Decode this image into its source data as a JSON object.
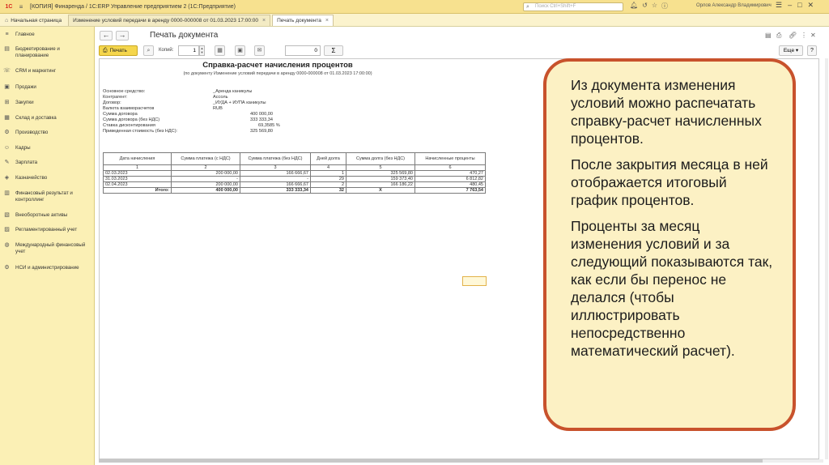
{
  "titlebar": {
    "app_title": "[КОПИЯ] Финаренда / 1С:ERP Управление предприятием 2  (1С:Предприятие)",
    "search_placeholder": "Поиск Ctrl+Shift+F",
    "user": "Орлов Александр Владимирович"
  },
  "tabs": {
    "home": "Начальная страница",
    "items": [
      {
        "label": "Изменение условий передачи в аренду 0000-000008 от 01.03.2023 17:00:00"
      },
      {
        "label": "Печать документа"
      }
    ]
  },
  "sidebar": {
    "items": [
      {
        "label": "Главное",
        "icon": "menu-icon"
      },
      {
        "label": "Бюджетирование и планирование",
        "icon": "chart-icon"
      },
      {
        "label": "CRM и маркетинг",
        "icon": "crm-icon"
      },
      {
        "label": "Продажи",
        "icon": "sales-icon"
      },
      {
        "label": "Закупки",
        "icon": "cart-icon"
      },
      {
        "label": "Склад и доставка",
        "icon": "warehouse-icon"
      },
      {
        "label": "Производство",
        "icon": "factory-icon"
      },
      {
        "label": "Кадры",
        "icon": "people-icon"
      },
      {
        "label": "Зарплата",
        "icon": "salary-icon"
      },
      {
        "label": "Казначейство",
        "icon": "treasury-icon"
      },
      {
        "label": "Финансовый результат и контроллинг",
        "icon": "finance-icon"
      },
      {
        "label": "Внеоборотные активы",
        "icon": "assets-icon"
      },
      {
        "label": "Регламентированный учет",
        "icon": "ledger-icon"
      },
      {
        "label": "Международный финансовый учет",
        "icon": "globe-icon"
      },
      {
        "label": "НСИ и администрирование",
        "icon": "gear-icon"
      }
    ]
  },
  "document": {
    "title": "Печать документа",
    "print_label": "Печать",
    "copies_label": "Копий:",
    "copies_value": "1",
    "sum_value": "0",
    "sum_symbol": "Σ",
    "more_label": "Еще"
  },
  "report": {
    "title": "Справка-расчет начисления процентов",
    "subtitle": "(по документу Изменение условий передачи в аренду 0000-000008 от 01.03.2023 17:00:00)",
    "fields": [
      {
        "label": "Основное средство:",
        "value": "_Аренда каникулы"
      },
      {
        "label": "Контрагент:",
        "value": "Ассоль"
      },
      {
        "label": "Договор:",
        "value": "_ИУДА + ИУПА каникулы"
      },
      {
        "label": "Валюта взаиморасчетов",
        "value": "RUB"
      },
      {
        "label": "Сумма договора",
        "value": "400 000,00"
      },
      {
        "label": "Сумма договора (без НДС)",
        "value": "333 333,34"
      },
      {
        "label": "Ставка дисконтирования",
        "value": "69,3585  %"
      },
      {
        "label": "Приведенная стоимость (без НДС):",
        "value": "325 569,80"
      }
    ],
    "table": {
      "headers": [
        "Дата начисления",
        "Сумма платежа (с НДС)",
        "Сумма платежа (без НДС)",
        "Дней долга",
        "Сумма долга (без НДС)",
        "Начисленные проценты"
      ],
      "col_numbers": [
        "1",
        "2",
        "3",
        "4",
        "5",
        "6"
      ],
      "rows": [
        [
          "02.03.2023",
          "200 000,00",
          "166 666,67",
          "1",
          "325 569,80",
          "470,27"
        ],
        [
          "31.03.2023",
          "-",
          "-",
          "29",
          "159 373,40",
          "6 812,82"
        ],
        [
          "02.04.2023",
          "200 000,00",
          "166 666,67",
          "2",
          "166 186,22",
          "480,45"
        ]
      ],
      "total": [
        "Итого:",
        "400 000,00",
        "333 333,34",
        "32",
        "X",
        "7 763,54"
      ]
    }
  },
  "callout": {
    "paragraphs": [
      "Из документа изменения условий можно распечатать справку-расчет начисленных процентов.",
      "После закрытия месяца в ней отображается итоговый график процентов.",
      "Проценты за месяц изменения условий и за следующий показываются так, как если бы перенос не делался (чтобы иллюстрировать непосредственно математический расчет)."
    ]
  }
}
